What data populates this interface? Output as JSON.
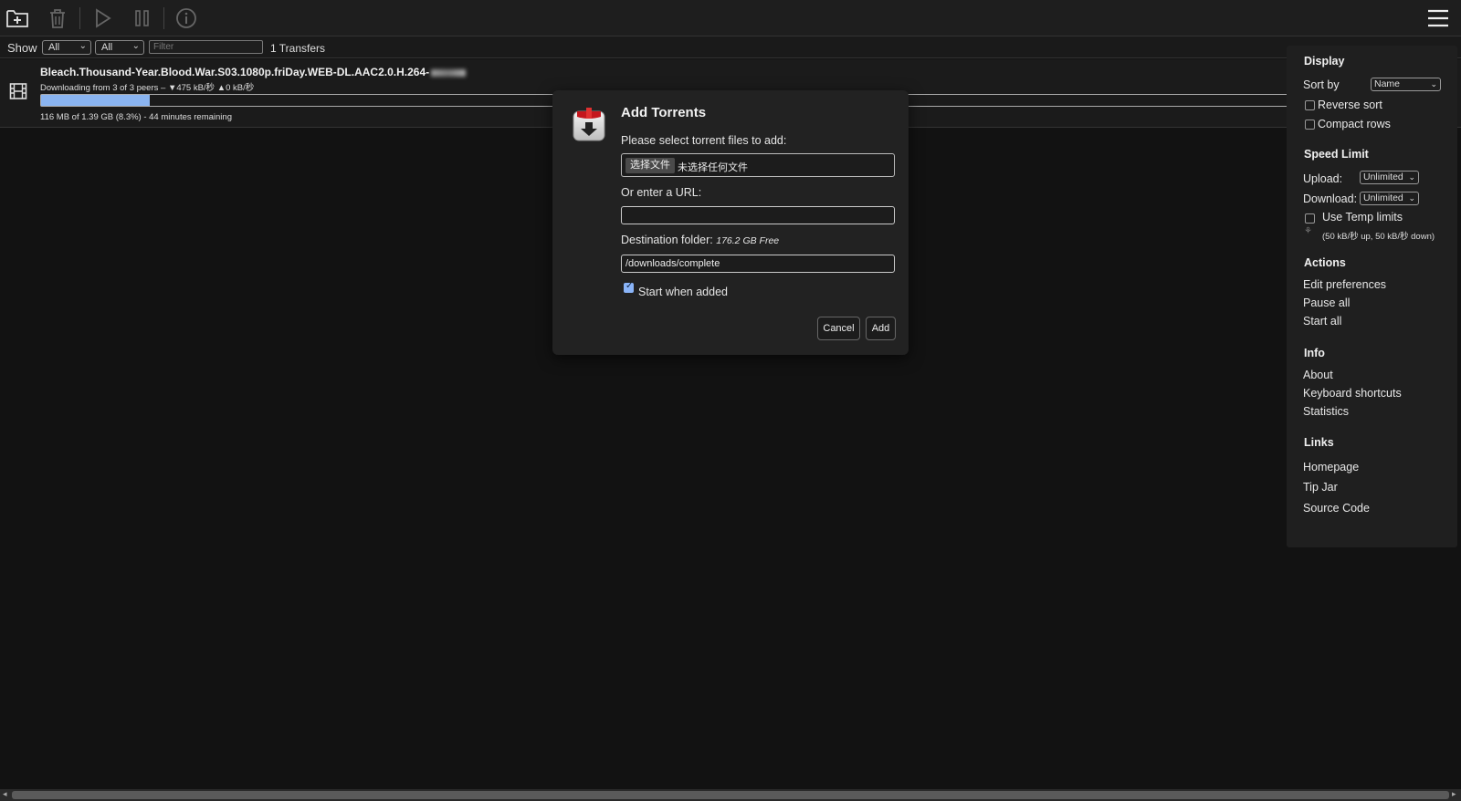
{
  "toolbar": {
    "icons": [
      "add-torrent-icon",
      "trash-icon",
      "play-icon",
      "pause-icon",
      "info-icon",
      "hamburger-menu-icon"
    ]
  },
  "filterbar": {
    "show_label": "Show",
    "status_select": "All",
    "tracker_select": "All",
    "filter_placeholder": "Filter",
    "transfers_count": "1 Transfers"
  },
  "torrent": {
    "name": "Bleach.Thousand-Year.Blood.War.S03.1080p.friDay.WEB-DL.AAC2.0.H.264-",
    "peers": "Downloading from 3 of 3 peers – ▼475 kB/秒 ▲0 kB/秒",
    "progress": 0.083,
    "details": "116 MB of 1.39 GB (8.3%) - 44 minutes remaining",
    "icon": "film-icon"
  },
  "modal": {
    "title": "Add Torrents",
    "select_label": "Please select torrent files to add:",
    "file_button": "选择文件",
    "file_status": "未选择任何文件",
    "url_label": "Or enter a URL:",
    "url_value": "",
    "dest_label": "Destination folder:",
    "dest_free": "176.2 GB Free",
    "dest_value": "/downloads/complete",
    "start_label": "Start when added",
    "start_checked": true,
    "cancel": "Cancel",
    "add": "Add"
  },
  "sidemenu": {
    "display_heading": "Display",
    "sort_by_label": "Sort by",
    "sort_by_value": "Name",
    "reverse_sort": "Reverse sort",
    "compact_rows": "Compact rows",
    "speed_heading": "Speed Limit",
    "upload_label": "Upload:",
    "upload_value": "Unlimited",
    "download_label": "Download:",
    "download_value": "Unlimited",
    "temp_limits": "Use Temp limits",
    "temp_values": "(50 kB/秒 up, 50 kB/秒 down)",
    "actions_heading": "Actions",
    "edit_prefs": "Edit preferences",
    "pause_all": "Pause all",
    "start_all": "Start all",
    "info_heading": "Info",
    "about": "About",
    "shortcuts": "Keyboard shortcuts",
    "statistics": "Statistics",
    "links_heading": "Links",
    "homepage": "Homepage",
    "tip_jar": "Tip Jar",
    "source_code": "Source Code"
  },
  "colors": {
    "progress_fill": "#8ab4f0",
    "accent_check": "#8ab4f8"
  }
}
